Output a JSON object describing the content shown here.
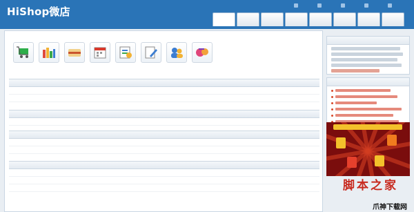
{
  "header": {
    "logo": "HiShop微店",
    "subtitle": "",
    "top_links": [
      "",
      "",
      "",
      "",
      ""
    ],
    "tabs": [
      "",
      "",
      "",
      "",
      "",
      "",
      "",
      ""
    ],
    "colors": {
      "header_bg": "#2a74b7",
      "tab_text": "#2a5b8a"
    }
  },
  "main": {
    "breadcrumb": "",
    "shortcuts": [
      {
        "icon": "shopping-cart-icon",
        "label": ""
      },
      {
        "icon": "bar-chart-icon",
        "label": ""
      },
      {
        "icon": "box-icon",
        "label": ""
      },
      {
        "icon": "calendar-icon",
        "label": ""
      },
      {
        "icon": "report-icon",
        "label": ""
      },
      {
        "icon": "edit-document-icon",
        "label": ""
      },
      {
        "icon": "users-icon",
        "label": ""
      },
      {
        "icon": "gift-icon",
        "label": ""
      }
    ],
    "sections": [
      {
        "title": "",
        "rows": [
          [
            "",
            ""
          ],
          [
            "",
            ""
          ]
        ]
      },
      {
        "title": "",
        "rows": [
          [
            "",
            "",
            "",
            ""
          ]
        ]
      },
      {
        "title": "",
        "rows": [
          [
            "",
            "",
            "",
            ""
          ],
          [
            "",
            "",
            "",
            ""
          ]
        ]
      },
      {
        "title": "",
        "rows": [
          [
            "",
            "",
            "",
            ""
          ],
          [
            "",
            "",
            "",
            ""
          ],
          [
            "",
            "",
            "",
            ""
          ]
        ]
      }
    ]
  },
  "sidebar": {
    "company_title": "",
    "news_title": "",
    "colors": {
      "news_link": "#d94a2b"
    }
  },
  "watermark": {
    "cn": "脚本之家",
    "url": "",
    "brand": "爪神下载网"
  }
}
